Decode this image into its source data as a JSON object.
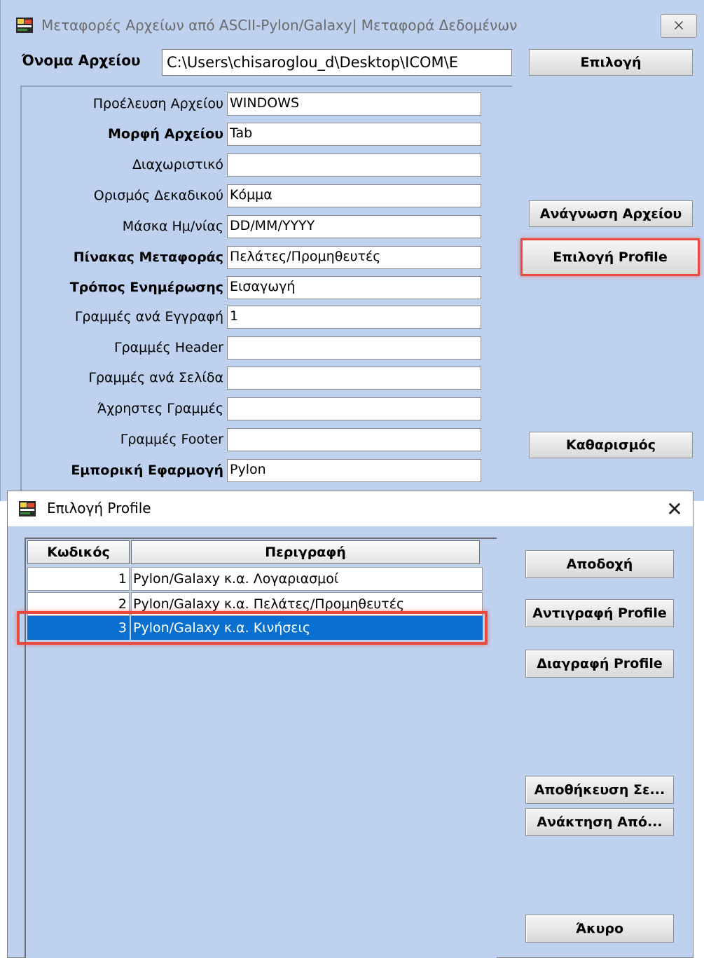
{
  "main_window": {
    "title": "Μεταφορές Αρχείων από ASCII-Pylon/Galaxy| Μεταφορά Δεδομένων",
    "close_glyph": "⨉",
    "file_name_label": "Όνομα Αρχείου",
    "file_name_value": "C:\\Users\\chisaroglou_d\\Desktop\\ICOM\\E",
    "buttons": {
      "select": "Επιλογή",
      "read_file": "Ανάγνωση Αρχείου",
      "select_profile": "Επιλογή Profile",
      "clear": "Καθαρισμός"
    },
    "fields": [
      {
        "label": "Προέλευση Αρχείου",
        "value": "WINDOWS",
        "bold": false
      },
      {
        "label": "Μορφή Αρχείου",
        "value": "Tab",
        "bold": true
      },
      {
        "label": "Διαχωριστικό",
        "value": "",
        "bold": false
      },
      {
        "label": "Ορισμός Δεκαδικού",
        "value": "Κόμμα",
        "bold": false
      },
      {
        "label": "Μάσκα Ημ/νίας",
        "value": "DD/MM/YYYY",
        "bold": false
      },
      {
        "label": "Πίνακας Μεταφοράς",
        "value": "Πελάτες/Προμηθευτές",
        "bold": true
      },
      {
        "label": "Τρόπος Ενημέρωσης",
        "value": "Εισαγωγή",
        "bold": true
      },
      {
        "label": "Γραμμές ανά Εγγραφή",
        "value": "1",
        "bold": false
      },
      {
        "label": "Γραμμές Header",
        "value": "",
        "bold": false
      },
      {
        "label": "Γραμμές ανά Σελίδα",
        "value": "",
        "bold": false
      },
      {
        "label": "Άχρηστες Γραμμές",
        "value": "",
        "bold": false
      },
      {
        "label": "Γραμμές Footer",
        "value": "",
        "bold": false
      },
      {
        "label": "Εμπορική Εφαρμογή",
        "value": "Pylon",
        "bold": true
      }
    ]
  },
  "profile_dialog": {
    "title": "Επιλογή Profile",
    "close_glyph": "✕",
    "columns": {
      "code": "Κωδικός",
      "description": "Περιγραφή"
    },
    "rows": [
      {
        "code": "1",
        "description": "Pylon/Galaxy κ.α. Λογαριασμοί",
        "selected": false
      },
      {
        "code": "2",
        "description": "Pylon/Galaxy κ.α. Πελάτες/Προμηθευτές",
        "selected": false
      },
      {
        "code": "3",
        "description": "Pylon/Galaxy κ.α. Κινήσεις",
        "selected": true
      }
    ],
    "buttons": {
      "accept": "Αποδοχή",
      "copy_profile": "Αντιγραφή Profile",
      "delete_profile": "Διαγραφή Profile",
      "save_to": "Αποθήκευση Σε...",
      "restore_from": "Ανάκτηση Από...",
      "cancel": "Άκυρο"
    }
  },
  "colors": {
    "window_bg": "#bed2f0",
    "selection": "#0a70d0",
    "highlight_frame": "#e94a3d"
  }
}
